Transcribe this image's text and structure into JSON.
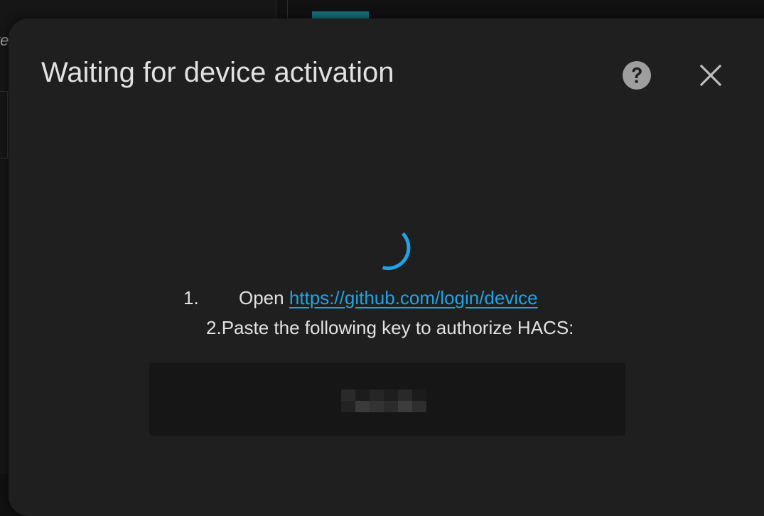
{
  "background": {
    "partial_left_text": "te"
  },
  "dialog": {
    "title": "Waiting for device activation",
    "help_icon": "help-circle-icon",
    "close_icon": "close-icon",
    "spinner_color": "#1ea4e6",
    "steps": [
      {
        "number": "1.",
        "prefix": "Open ",
        "link_text": "https://github.com/login/device"
      },
      {
        "number": "2.",
        "text": "Paste the following key to authorize HACS:"
      }
    ],
    "device_code": {
      "value": "",
      "redacted": true
    }
  },
  "colors": {
    "dialog_bg": "#1f1f1f",
    "text": "#e1e1e1",
    "link": "#1ea4e6",
    "code_bg": "#161616",
    "accent_tab": "#16707a"
  }
}
